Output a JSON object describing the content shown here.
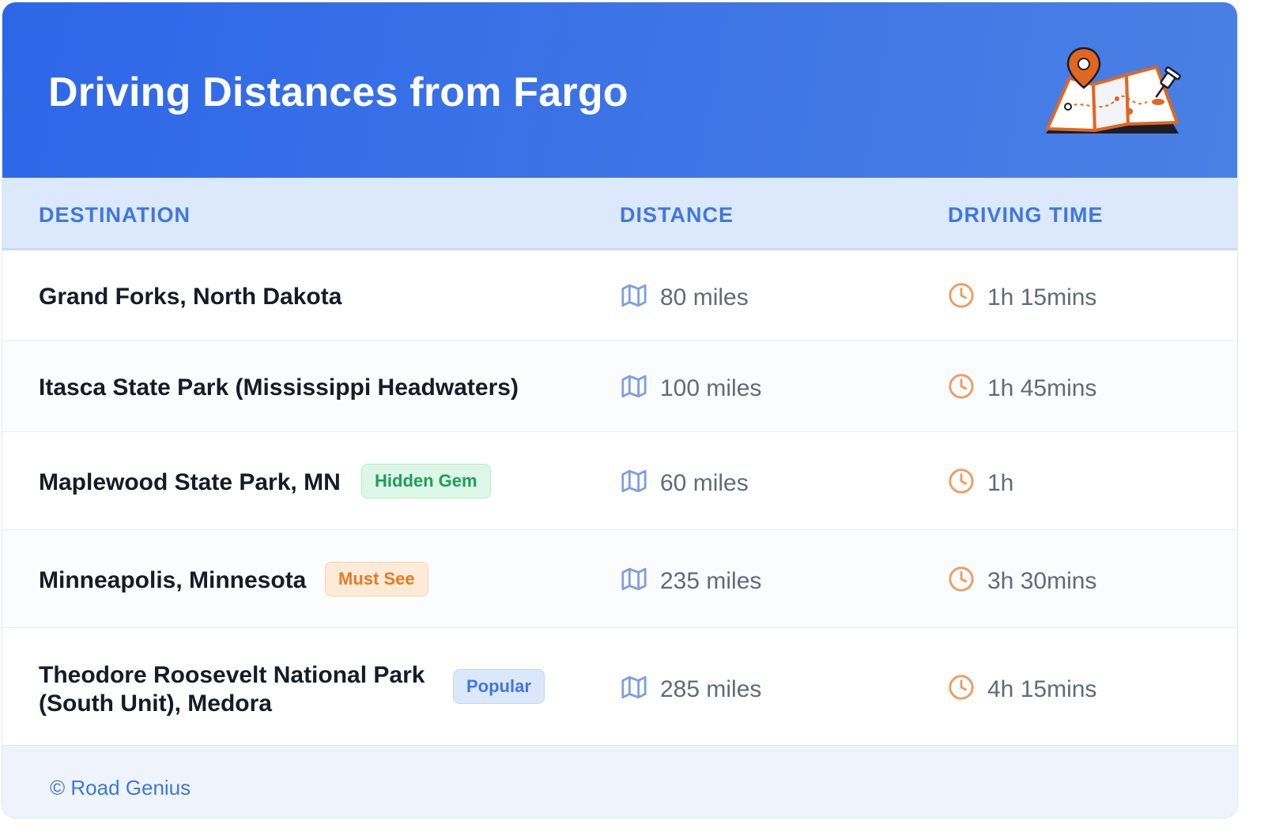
{
  "header": {
    "title": "Driving Distances from Fargo",
    "illustration_icon": "map-with-pin-icon"
  },
  "table": {
    "columns": [
      "DESTINATION",
      "DISTANCE",
      "DRIVING TIME"
    ],
    "rows": [
      {
        "destination": "Grand Forks, North Dakota",
        "badge": "",
        "distance": "80 miles",
        "time": "1h 15mins"
      },
      {
        "destination": "Itasca State Park (Mississippi Headwaters)",
        "badge": "",
        "distance": "100 miles",
        "time": "1h 45mins"
      },
      {
        "destination": "Maplewood State Park, MN",
        "badge": "Hidden Gem",
        "distance": "60 miles",
        "time": "1h"
      },
      {
        "destination": "Minneapolis, Minnesota",
        "badge": "Must See",
        "distance": "235 miles",
        "time": "3h 30mins"
      },
      {
        "destination_line1": "Theodore Roosevelt National Park",
        "destination_line2": "(South Unit), Medora",
        "badge": "Popular",
        "distance": "285 miles",
        "time": "4h 15mins"
      }
    ],
    "distance_icon": "map-icon",
    "time_icon": "clock-icon"
  },
  "footer": {
    "credit": "© Road Genius"
  },
  "colors": {
    "header_gradient_start": "#2d67e8",
    "header_gradient_end": "#4a80e4",
    "column_header_text": "#3f78dc",
    "badge_green": "#1f9d58",
    "badge_orange": "#e67a24",
    "badge_blue": "#3f78dc",
    "map_icon": "#7f9fe0",
    "clock_icon": "#ee9b62"
  }
}
